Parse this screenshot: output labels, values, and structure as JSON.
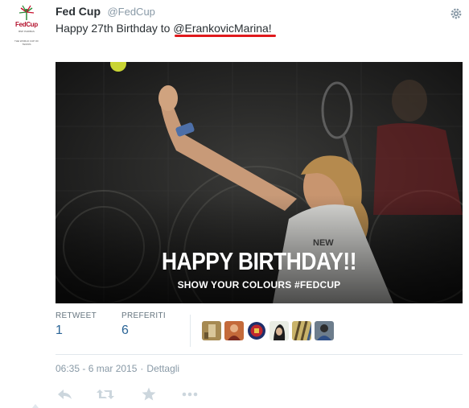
{
  "account": {
    "name": "Fed Cup",
    "handle": "@FedCup",
    "avatar_logo_text": "FedCup",
    "avatar_sub_text": "BNP PARIBAS",
    "avatar_tagline": "THE WORLD CUP OF TENNIS"
  },
  "tweet": {
    "text_before": "Happy 27th Birthday to ",
    "mention": "@ErankovicMarina",
    "text_after": "!",
    "highlight_color": "#e0191d"
  },
  "photo": {
    "title": "HAPPY BIRTHDAY!!",
    "subtitle": "SHOW YOUR COLOURS #FEDCUP",
    "shirt_text": "NEW"
  },
  "stats": {
    "retweet_label": "RETWEET",
    "retweet_count": "1",
    "favorites_label": "PREFERITI",
    "favorites_count": "6",
    "favoriters": [
      "user-avatar-1",
      "user-avatar-2",
      "user-avatar-3",
      "user-avatar-4",
      "user-avatar-5",
      "user-avatar-6"
    ]
  },
  "meta": {
    "timestamp": "06:35 - 6 mar 2015",
    "separator": "·",
    "details_link": "Dettagli"
  },
  "actions": [
    "reply-icon",
    "retweet-icon",
    "favorite-icon",
    "more-icon"
  ],
  "colors": {
    "link": "#2a6496",
    "muted": "#8899a6",
    "text": "#292f33",
    "brand_red": "#b3122e"
  }
}
